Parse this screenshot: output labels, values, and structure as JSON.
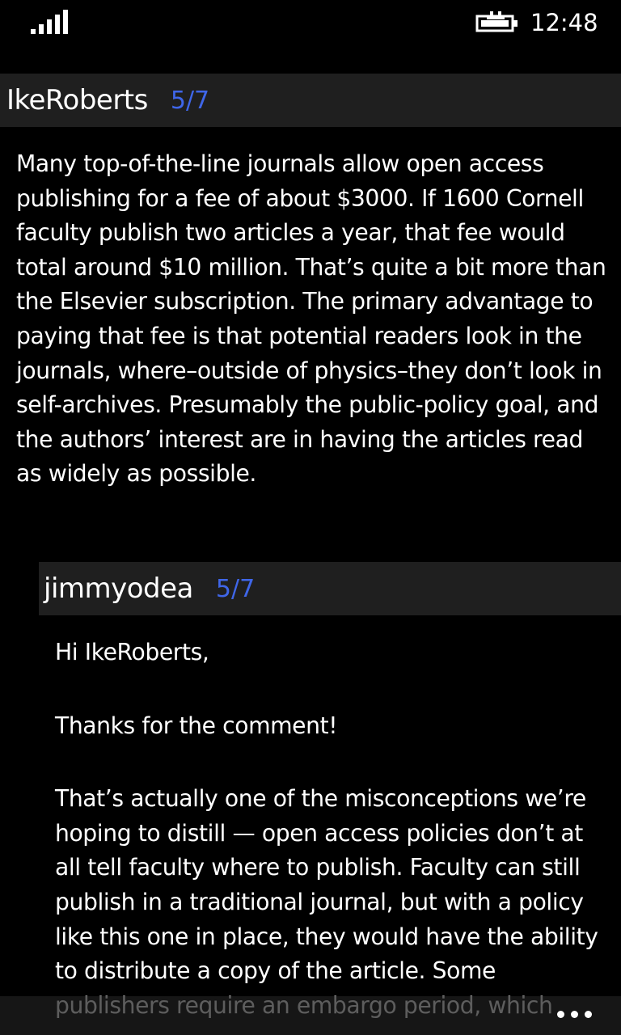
{
  "status": {
    "time": "12:48",
    "signal_icon": "signal-strength-icon",
    "battery_icon": "battery-charging-icon"
  },
  "comments": [
    {
      "author": "IkeRoberts",
      "rating": "5/7",
      "paragraphs": [
        "Many top-of-the-line journals allow open access publishing for a fee of about $3000. If 1600 Cornell faculty publish two articles a year, that fee would total around $10 million. That’s quite a bit more than the Elsevier subscription. The primary advantage to paying that fee is that potential readers look in the journals, where–outside of physics–they don’t look in self-archives. Presumably the public-policy goal, and the authors’ interest are in having the articles read as widely as possible."
      ]
    },
    {
      "author": "jimmyodea",
      "rating": "5/7",
      "paragraphs": [
        "Hi IkeRoberts,",
        "Thanks for the comment!",
        "That’s actually one of the misconceptions we’re hoping to distill — open access policies don’t at all tell faculty where to publish. Faculty can still publish in a traditional journal, but with a policy like this one in place, they would have the ability to distribute a copy of the article. Some publishers require an embargo period, which"
      ]
    }
  ],
  "app_bar": {
    "more_icon": "more-options-icon"
  },
  "colors": {
    "background": "#000000",
    "header_bg": "#1f1f1f",
    "accent": "#3f66e8",
    "text": "#ffffff"
  }
}
